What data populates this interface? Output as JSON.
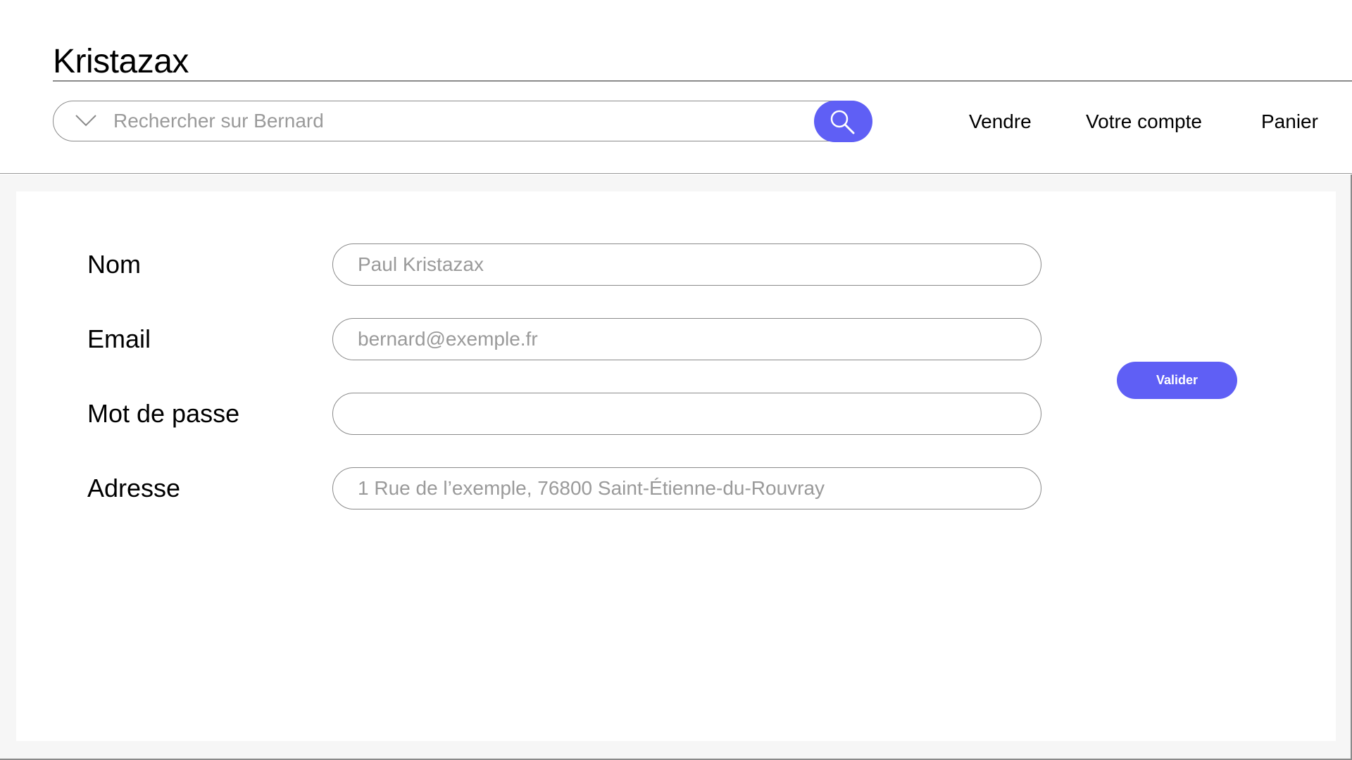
{
  "header": {
    "brand": "Kristazax",
    "search": {
      "placeholder": "Rechercher sur Bernard",
      "value": ""
    },
    "nav": {
      "sell": "Vendre",
      "account": "Votre compte",
      "cart": "Panier"
    }
  },
  "form": {
    "fields": [
      {
        "label": "Nom",
        "placeholder": "Paul Kristazax",
        "value": ""
      },
      {
        "label": "Email",
        "placeholder": "bernard@exemple.fr",
        "value": ""
      },
      {
        "label": "Mot de passe",
        "placeholder": "",
        "value": ""
      },
      {
        "label": "Adresse",
        "placeholder": "1 Rue de l’exemple, 76800 Saint-Étienne-du-Rouvray",
        "value": ""
      }
    ],
    "submit_label": "Valider"
  },
  "icons": {
    "search": "search-icon",
    "dropdown": "chevron-down-icon"
  },
  "colors": {
    "accent": "#5f5ff5",
    "background": "#f6f6f6",
    "border": "#8a8a8a"
  }
}
